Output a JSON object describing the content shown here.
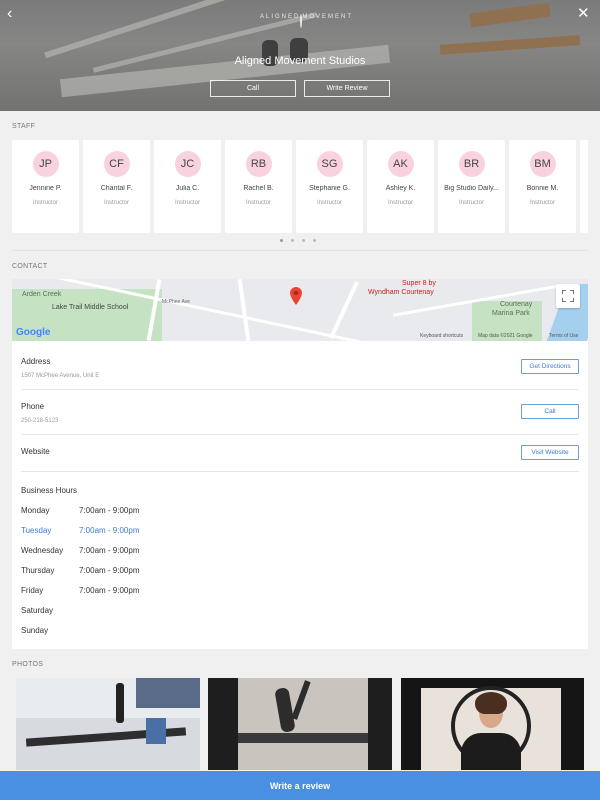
{
  "hero": {
    "logo_line1": "ALIGNED",
    "logo_line2": "MOVEMENT",
    "title": "Aligned Movement Studios",
    "call_label": "Call",
    "review_label": "Write Review"
  },
  "sections": {
    "staff": "STAFF",
    "contact": "CONTACT",
    "photos": "PHOTOS"
  },
  "staff": [
    {
      "initials": "JP",
      "name": "Jennine P.",
      "role": "Instructor"
    },
    {
      "initials": "CF",
      "name": "Chantal F.",
      "role": "Instructor"
    },
    {
      "initials": "JC",
      "name": "Julia C.",
      "role": "Instructor"
    },
    {
      "initials": "RB",
      "name": "Rachel B.",
      "role": "Instructor"
    },
    {
      "initials": "SG",
      "name": "Stephanie G.",
      "role": "Instructor"
    },
    {
      "initials": "AK",
      "name": "Ashley K.",
      "role": "Instructor"
    },
    {
      "initials": "BR",
      "name": "Big Studio Daily...",
      "role": "Instructor"
    },
    {
      "initials": "BM",
      "name": "Bonnie M.",
      "role": "Instructor"
    }
  ],
  "map": {
    "labels": {
      "arden_creek": "Arden Creek",
      "middle_school": "Lake Trail Middle School",
      "hotel": "Super 8 by",
      "hotel2": "Wyndham Courtenay",
      "marina": "Courtenay",
      "marina2": "Marina Park",
      "google": "Google",
      "keyboard": "Keyboard shortcuts",
      "mapdata": "Map data ©2021 Google",
      "terms": "Terms of Use"
    }
  },
  "contact": {
    "address_title": "Address",
    "address_value": "1507 McPhee Avenue, Unit E",
    "directions_label": "Get Directions",
    "phone_title": "Phone",
    "phone_value": "250-218-5123",
    "call_label": "Call",
    "website_title": "Website",
    "website_label": "Visit Website"
  },
  "hours": {
    "title": "Business Hours",
    "days": [
      {
        "day": "Monday",
        "time": "7:00am - 9:00pm"
      },
      {
        "day": "Tuesday",
        "time": "7:00am - 9:00pm"
      },
      {
        "day": "Wednesday",
        "time": "7:00am - 9:00pm"
      },
      {
        "day": "Thursday",
        "time": "7:00am - 9:00pm"
      },
      {
        "day": "Friday",
        "time": "7:00am - 9:00pm"
      },
      {
        "day": "Saturday",
        "time": ""
      },
      {
        "day": "Sunday",
        "time": ""
      }
    ]
  },
  "review_bar": "Write a review",
  "colors": {
    "accent": "#4a90e2",
    "avatar_bg": "#f8d3df",
    "today": "#3e7cc9"
  }
}
